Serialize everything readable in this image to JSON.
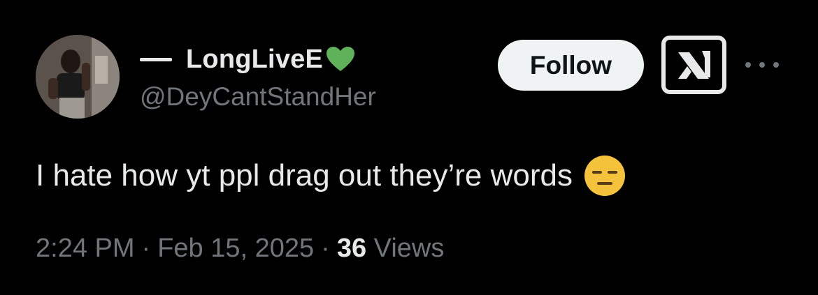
{
  "tweet": {
    "display_name": "LongLiveE",
    "handle": "@DeyCantStandHer",
    "text": "I hate how yt ppl drag out they’re words",
    "time": "2:24 PM",
    "date": "Feb 15, 2025",
    "views_count": "36",
    "views_label": "Views",
    "separator": "·"
  },
  "actions": {
    "follow_label": "Follow"
  },
  "icons": {
    "name_emoji": "green-heart-icon",
    "text_emoji": "expressionless-face-icon",
    "grok": "grok-icon",
    "more": "more-icon"
  },
  "colors": {
    "background": "#000000",
    "primary_text": "#e7e9ea",
    "secondary_text": "#71767b",
    "follow_bg": "#eff3f4",
    "heart": "#5fb25a",
    "emoji": "#f5c33b"
  }
}
